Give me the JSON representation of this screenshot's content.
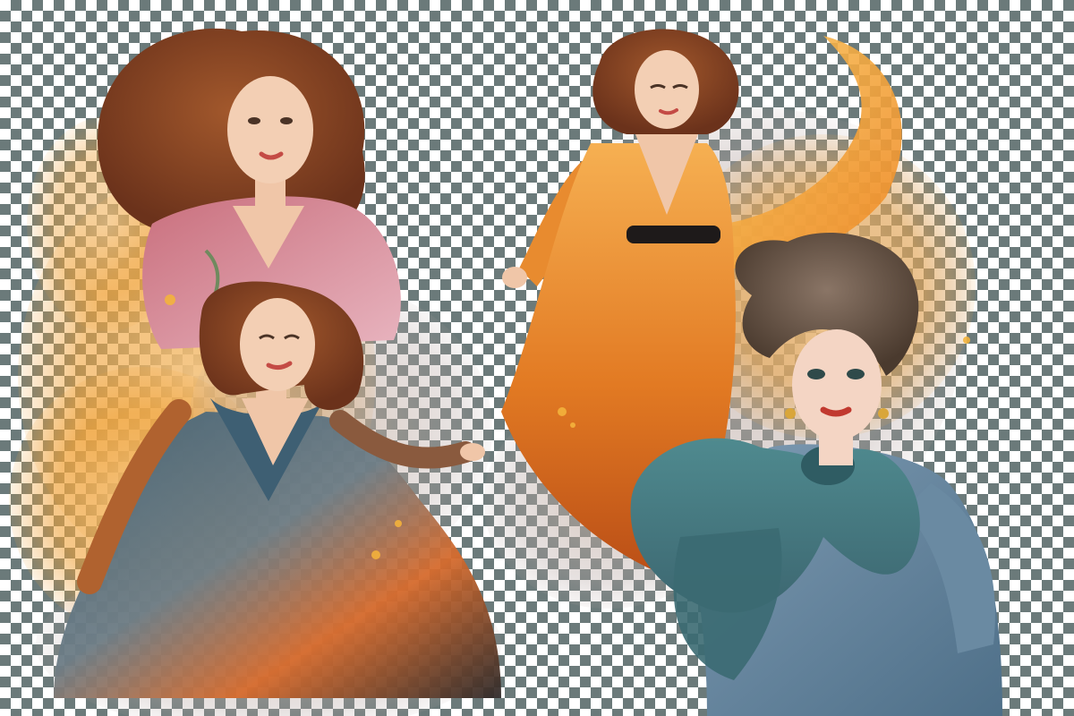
{
  "image": {
    "background": "transparency-checkerboard",
    "figures": [
      {
        "name": "woman-pink-blouse",
        "palette": [
          "#e6a6b3",
          "#b2585a",
          "#8a4a2c"
        ]
      },
      {
        "name": "woman-blue-orange-gown",
        "palette": [
          "#3f5f74",
          "#d9692e",
          "#a0452c"
        ]
      },
      {
        "name": "woman-orange-dress",
        "palette": [
          "#f29a3a",
          "#d86e1e",
          "#1c1c1c"
        ]
      },
      {
        "name": "woman-teal-bow-dress",
        "palette": [
          "#3f7b82",
          "#6d8ea8",
          "#5a4a3a"
        ]
      }
    ],
    "colors": {
      "checker_dark": "#6b7a7a",
      "checker_light": "#ffffff",
      "watercolor_orange": "#f0a33a",
      "watercolor_peach": "#f3c79a",
      "watercolor_gray": "#b7a7a4"
    }
  }
}
